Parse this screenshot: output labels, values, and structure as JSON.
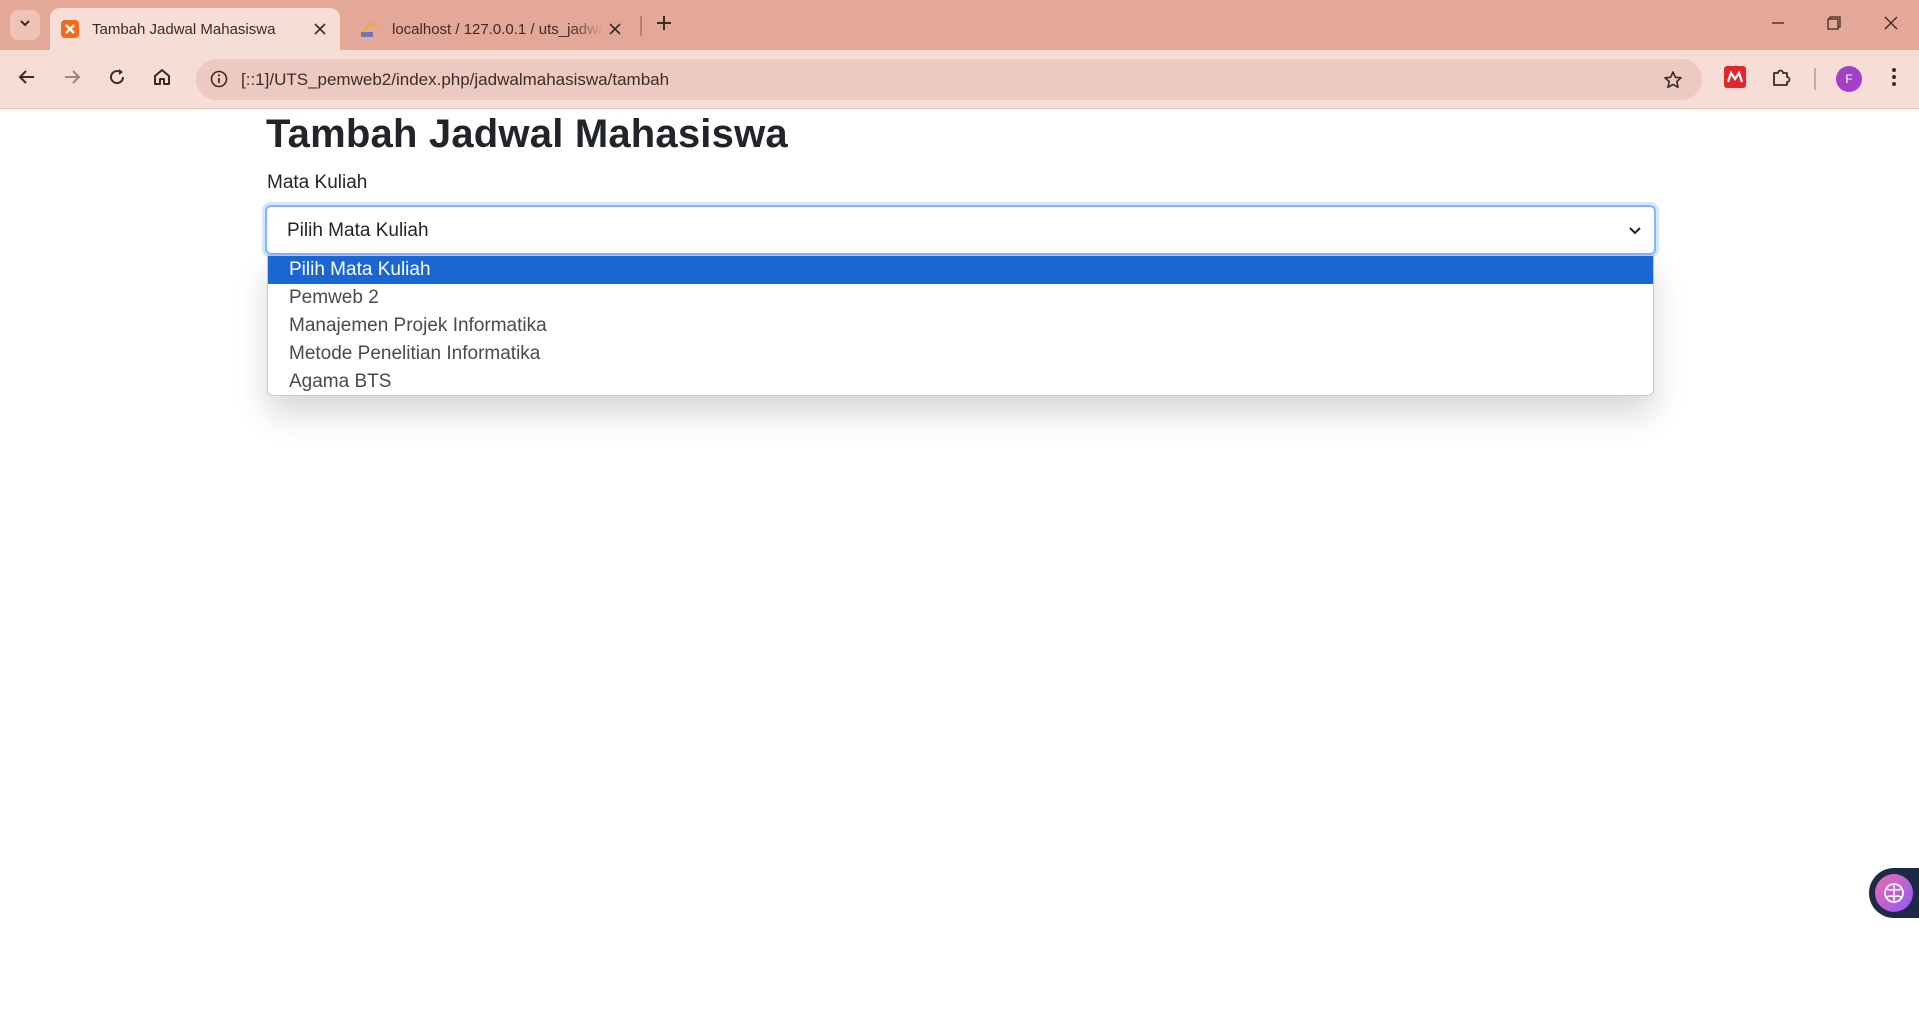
{
  "browser": {
    "tabs": [
      {
        "title": "Tambah Jadwal Mahasiswa",
        "active": true,
        "favicon": "xampp-icon"
      },
      {
        "title": "localhost / 127.0.0.1 / uts_jadwal",
        "active": false,
        "favicon": "phpmyadmin-icon"
      }
    ],
    "url": "[::1]/UTS_pemweb2/index.php/jadwalmahasiswa/tambah",
    "profile_initial": "F",
    "colors": {
      "frame": "#e4a899",
      "toolbar": "#f6ddd6",
      "omnibox": "#ecc9c1",
      "avatar": "#a340c8"
    }
  },
  "page": {
    "title": "Tambah Jadwal Mahasiswa",
    "field_label": "Mata Kuliah",
    "select_value": "Pilih Mata Kuliah",
    "options": [
      {
        "label": "Pilih Mata Kuliah",
        "selected": true
      },
      {
        "label": "Pemweb 2",
        "selected": false
      },
      {
        "label": "Manajemen Projek Informatika",
        "selected": false
      },
      {
        "label": "Metode Penelitian Informatika",
        "selected": false
      },
      {
        "label": "Agama BTS",
        "selected": false
      }
    ],
    "colors": {
      "selected_option": "#1a66d3",
      "focus_border": "#86b7fe"
    }
  }
}
